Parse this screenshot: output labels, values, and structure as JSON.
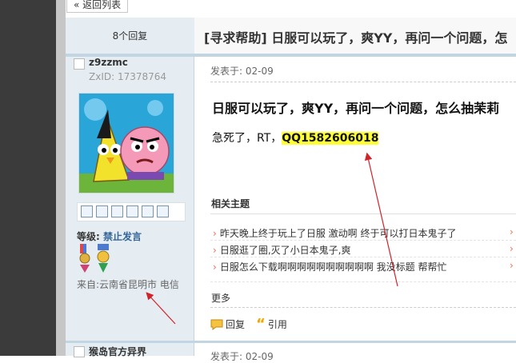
{
  "nav": {
    "back_label": "« 返回列表"
  },
  "thread": {
    "reply_count": "8个回复",
    "title": "[寻求帮助] 日服可以玩了，爽YY，再问一个问题，怎"
  },
  "author": {
    "name": "z9zzmc",
    "zxid": "ZxID:  17378764",
    "level_label": "等级:",
    "level_value": "禁止发言",
    "location": "来自:云南省昆明市 电信"
  },
  "post": {
    "date": "发表于: 02-09",
    "title": "日服可以玩了，爽YY，再问一个问题，怎么抽茉莉",
    "body_text": "急死了，RT，",
    "body_highlight": "QQ1582606018"
  },
  "related": {
    "heading": "相关主题",
    "items": [
      "昨天晚上终于玩上了日服  激动啊 终于可以打日本鬼子了",
      "日服逛了圈,灭了小日本鬼子,爽",
      "日服怎么下载啊啊啊啊啊啊啊啊啊啊  我没标题 帮帮忙"
    ]
  },
  "more_label": "更多",
  "actions": {
    "reply_label": "回复",
    "quote_label": "引用"
  },
  "next_post": {
    "author": "猴岛官方异界",
    "date": "发表于: 02-09"
  },
  "colors": {
    "accent_blue": "#336699",
    "highlight": "#ffff33",
    "arrow_red": "#d0232a"
  }
}
